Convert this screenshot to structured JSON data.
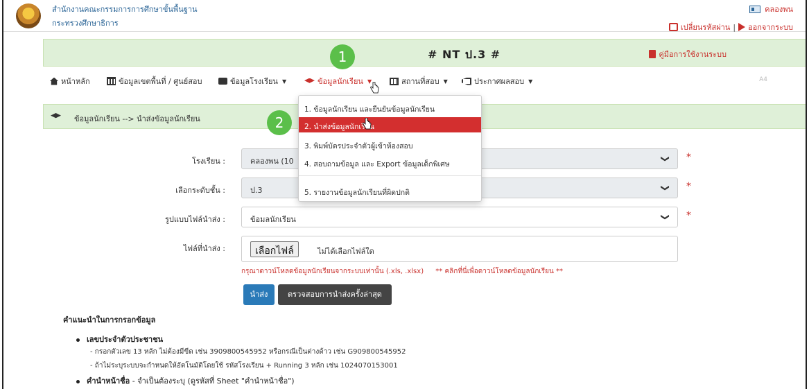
{
  "header": {
    "org_line1": "สำนักงานคณะกรรมการการศึกษาขั้นพื้นฐาน",
    "org_line2": "กระทรวงศึกษาธิการ",
    "user_name": "คลองพน",
    "change_password": "เปลี่ยนรหัสผ่าน",
    "separator": "|",
    "logout": "ออกจากระบบ"
  },
  "banner": {
    "title": "# NT ป.3 #",
    "manual_link": "คู่มือการใช้งานระบบ"
  },
  "nav": {
    "home": "หน้าหลัก",
    "area_data": "ข้อมูลเขตพื้นที่ / ศูนย์สอบ",
    "school_data": "ข้อมูลโรงเรียน",
    "student_data": "ข้อมูลนักเรียน",
    "exam_site": "สถานที่สอบ",
    "announce": "ประกาศผลสอบ",
    "right_hint": "A4"
  },
  "breadcrumb": "ข้อมูลนักเรียน --> นำส่งข้อมูลนักเรียน",
  "dropdown": {
    "items": [
      "1. ข้อมูลนักเรียน และยืนยันข้อมูลนักเรียน",
      "2. นำส่งข้อมูลนักเรียน",
      "3. พิมพ์บัตรประจำตัวผู้เข้าห้องสอบ",
      "4. สอบถามข้อมูล และ Export ข้อมูลเด็กพิเศษ",
      "5. รายงานข้อมูลนักเรียนที่ผิดปกติ"
    ],
    "active_index": 1
  },
  "form": {
    "school_label": "โรงเรียน :",
    "school_value": "คลองพน (10",
    "grade_label": "เลือกระดับชั้น :",
    "grade_value": "ป.3",
    "filetype_label": "รูปแบบไฟล์นำส่ง :",
    "filetype_value": "ข้อมลนักเรียน",
    "file_label": "ไฟล์ที่นำส่ง :",
    "file_button": "เลือกไฟล์",
    "file_none": "ไม่ได้เลือกไฟล์ใด",
    "required_mark": "*",
    "hint_main": "กรุณาดาวน์โหลดข้อมูลนักเรียนจากระบบเท่านั้น (.xls, .xlsx)",
    "hint_link": "** คลิกที่นี่เพื่อดาวน์โหลดข้อมูลนักเรียน **",
    "submit_button": "นำส่ง",
    "check_button": "ตรวจสอบการนำส่งครั้งล่าสุด",
    "chevron": "❯"
  },
  "instructions": {
    "title": "คำแนะนำในการกรอกข้อมูล",
    "id_heading": "เลขประจำตัวประชาชน",
    "id_line1": "- กรอกตัวเลข 13 หลัก ไม่ต้องมีขีด เช่น 3909800545952 หรือกรณีเป็นต่างด้าว เช่น G909800545952",
    "id_line2": "- ถ้าไม่ระบุระบบจะกำหนดให้อัตโนมัติโดยใช้ รหัสโรงเรียน + Running 3 หลัก เช่น 1024070153001",
    "prefix_heading": "คำนำหน้าชื่อ",
    "prefix_text": " - จำเป็นต้องระบุ (ดูรหัสที่ Sheet \"คำนำหน้าชื่อ\")"
  },
  "annotations": {
    "step1": "1",
    "step2": "2"
  },
  "colors": {
    "accent_red": "#c9302c",
    "banner_green": "#dff0d8",
    "badge_green": "#5bbf4a",
    "primary_blue": "#2a7ab8"
  }
}
